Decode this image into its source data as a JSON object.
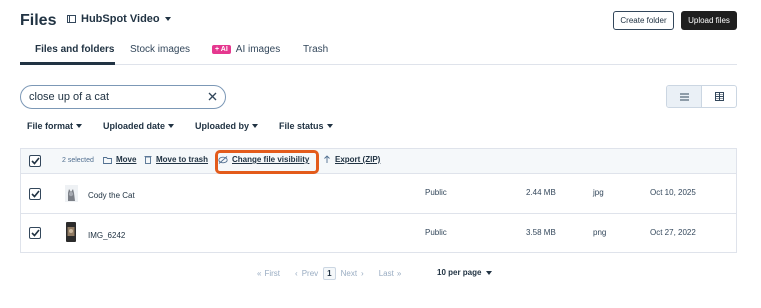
{
  "header": {
    "title": "Files",
    "account": "HubSpot Video",
    "create_folder": "Create folder",
    "upload_files": "Upload files"
  },
  "tabs": [
    {
      "label": "Files and folders",
      "active": true
    },
    {
      "label": "Stock images",
      "active": false
    },
    {
      "badge": "+ AI",
      "label": "AI images",
      "active": false
    },
    {
      "label": "Trash",
      "active": false
    }
  ],
  "search": {
    "value": "close up of a cat"
  },
  "view": {
    "selected": "list"
  },
  "filters": [
    "File format",
    "Uploaded date",
    "Uploaded by",
    "File status"
  ],
  "bulk": {
    "selected_count": "2 selected",
    "actions": [
      "Move",
      "Move to trash",
      "Change file visibility",
      "Export (ZIP)"
    ],
    "highlighted_action": "Change file visibility"
  },
  "rows": [
    {
      "name": "Cody the Cat",
      "visibility": "Public",
      "size": "2.44 MB",
      "type": "jpg",
      "date": "Oct 10, 2025",
      "checked": true
    },
    {
      "name": "IMG_6242",
      "visibility": "Public",
      "size": "3.58 MB",
      "type": "png",
      "date": "Oct 27, 2022",
      "checked": true
    }
  ],
  "pagination": {
    "first": "First",
    "prev": "Prev",
    "current_page": "1",
    "next": "Next",
    "last": "Last",
    "per_page": "10 per page"
  },
  "colors": {
    "accent_highlight": "#e35b1b",
    "ai_badge": "#e5388f"
  }
}
